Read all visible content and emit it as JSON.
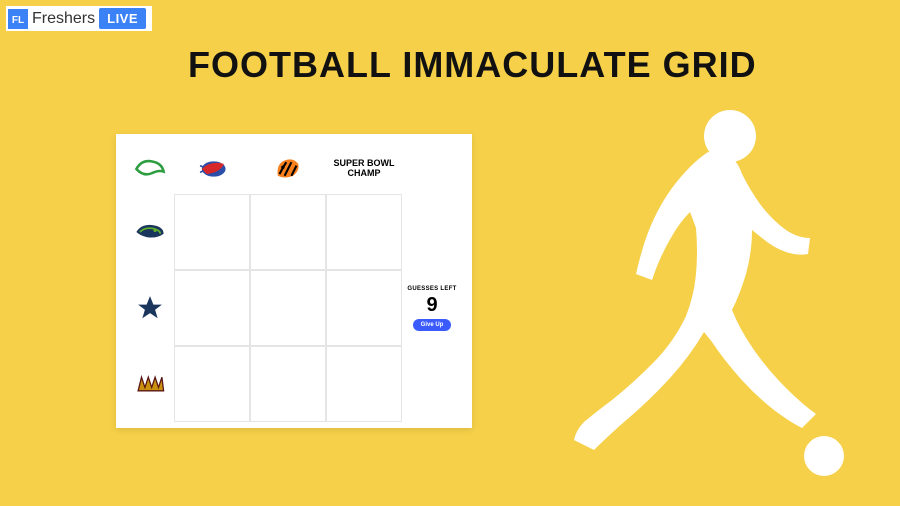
{
  "brand": {
    "icon_letter": "FL",
    "name": "Freshers",
    "badge": "LIVE"
  },
  "title": "FOOTBALL IMMACULATE GRID",
  "grid": {
    "col_headers": [
      {
        "type": "icon",
        "name": "bills-logo"
      },
      {
        "type": "icon",
        "name": "bengals-logo"
      },
      {
        "type": "text",
        "label": "SUPER BOWL CHAMP"
      }
    ],
    "row_headers": [
      {
        "name": "seahawks-logo"
      },
      {
        "name": "cowboys-logo"
      },
      {
        "name": "commanders-logo"
      }
    ],
    "corner": {
      "name": "grid-logo"
    },
    "guesses_label": "GUESSES LEFT",
    "guesses_left": "9",
    "giveup_label": "Give Up"
  }
}
